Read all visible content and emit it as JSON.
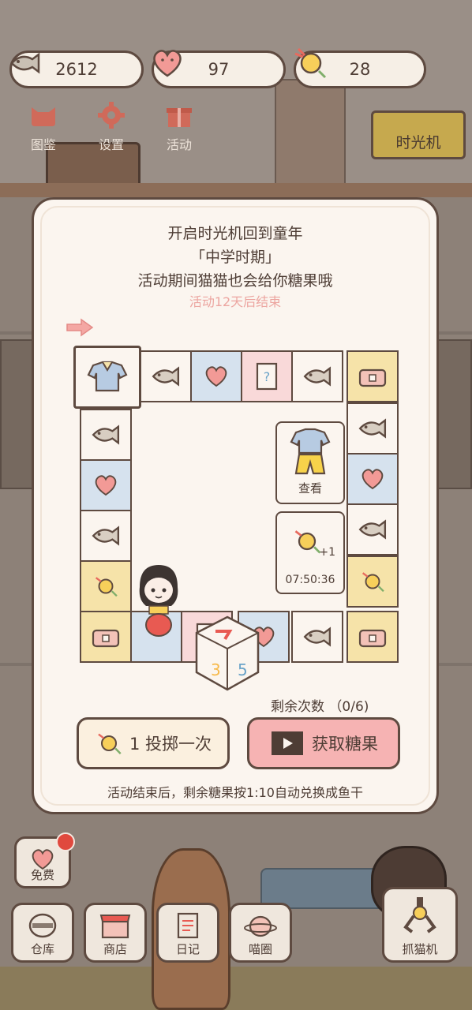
{
  "stats": {
    "fish": "2612",
    "hearts": "97",
    "candy": "28"
  },
  "top_icons": [
    {
      "label": "图鉴",
      "icon": "cat-head-icon"
    },
    {
      "label": "设置",
      "icon": "gear-icon"
    },
    {
      "label": "活动",
      "icon": "gift-icon"
    }
  ],
  "time_machine_label": "时光机",
  "modal": {
    "line1": "开启时光机回到童年",
    "line2": "「中学时期」",
    "line3": "活动期间猫猫也会给你糖果哦",
    "countdown": "活动12天后结束",
    "view_label": "查看",
    "candy_bonus": "+1",
    "timer": "07:50:36",
    "remaining": "剩余次数 （0/6)",
    "roll_button": "1 投掷一次",
    "get_candy_button": "获取糖果",
    "footnote": "活动结束后，剩余糖果按1:10自动兑换成鱼干"
  },
  "board_tiles": [
    "clothes",
    "fish",
    "heart",
    "mystery-book",
    "fish",
    "chest",
    "fish",
    "heart",
    "fish",
    "candy",
    "chest",
    "mystery-book",
    "heart",
    "fish",
    "chest",
    "candy",
    "fish",
    "heart",
    "fish"
  ],
  "bottom_nav": [
    {
      "label": "免费",
      "icon": "heart-icon"
    },
    {
      "label": "仓库",
      "icon": "storage-icon"
    },
    {
      "label": "商店",
      "icon": "shop-icon"
    },
    {
      "label": "日记",
      "icon": "diary-icon"
    },
    {
      "label": "喵圈",
      "icon": "planet-icon"
    },
    {
      "label": "抓猫机",
      "icon": "claw-icon"
    }
  ]
}
